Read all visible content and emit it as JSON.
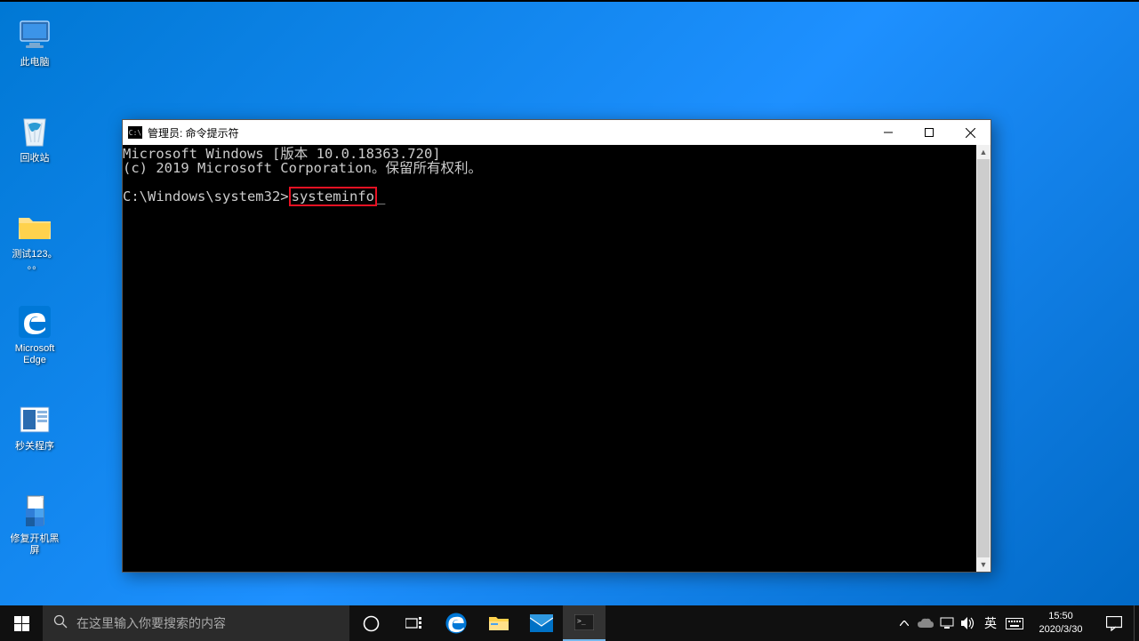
{
  "desktop": {
    "icons": [
      {
        "label": "此电脑"
      },
      {
        "label": "回收站"
      },
      {
        "label": "测试123。\n。。"
      },
      {
        "label": "Microsoft\nEdge"
      },
      {
        "label": "秒关程序"
      },
      {
        "label": "修复开机黑\n屏"
      }
    ]
  },
  "cmd": {
    "title": "管理员: 命令提示符",
    "icon_text": "C:\\",
    "line1": "Microsoft Windows [版本 10.0.18363.720]",
    "line2": "(c) 2019 Microsoft Corporation。保留所有权利。",
    "prompt": "C:\\Windows\\system32>",
    "input": "systeminfo",
    "highlight_color": "#e81123"
  },
  "taskbar": {
    "search_placeholder": "在这里输入你要搜索的内容",
    "ime": "英",
    "time": "15:50",
    "date": "2020/3/30"
  }
}
